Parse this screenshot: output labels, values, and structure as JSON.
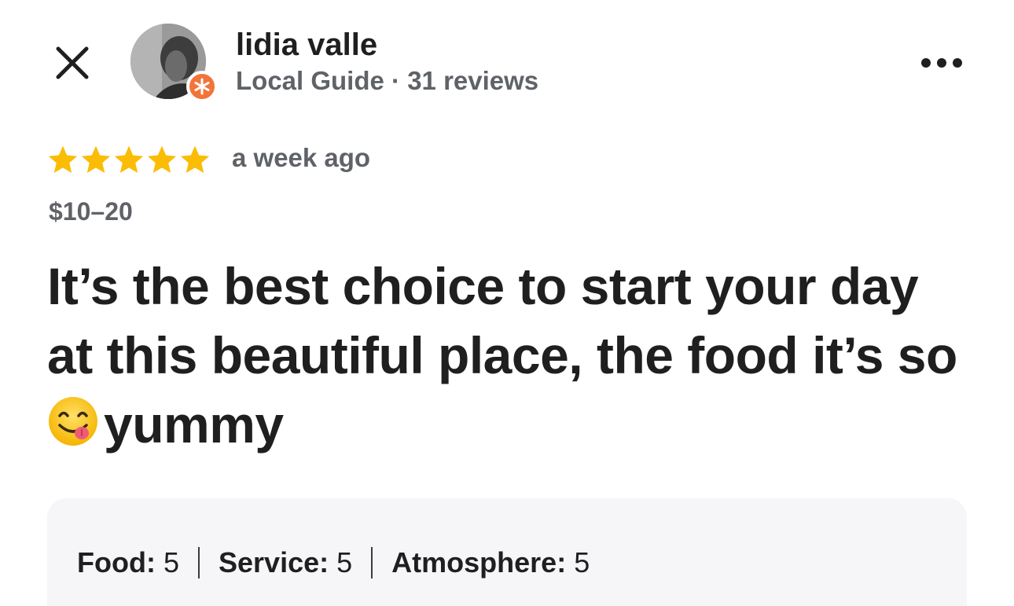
{
  "reviewer": {
    "name": "lidia valle",
    "meta": "Local Guide · 31 reviews",
    "badge_color": "#f2743a"
  },
  "review": {
    "rating": 5,
    "max_rating": 5,
    "star_color": "#fbbc04",
    "time_ago": "a week ago",
    "price": "$10–20",
    "text_before_emoji": "It’s the best choice to start your day at this beautiful place, the food it’s so ",
    "emoji": "face-savoring-food",
    "text_after_emoji": "yummy"
  },
  "ratings": {
    "food_label": "Food:",
    "food_value": "5",
    "service_label": "Service:",
    "service_value": "5",
    "atmosphere_label": "Atmosphere:",
    "atmosphere_value": "5"
  },
  "icons": {
    "close": "close-icon",
    "more": "more-horizontal-icon",
    "badge": "local-guide-star-icon"
  }
}
